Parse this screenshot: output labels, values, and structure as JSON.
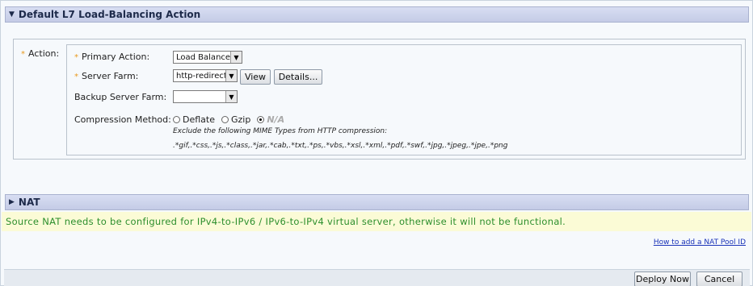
{
  "l7_section": {
    "title": "Default L7 Load-Balancing Action",
    "action_label": "Action:",
    "primary_action": {
      "label": "Primary Action:",
      "value": "Load Balance"
    },
    "server_farm": {
      "label": "Server Farm:",
      "value": "http-redirect",
      "view_label": "View",
      "details_label": "Details..."
    },
    "backup_server_farm": {
      "label": "Backup Server Farm:",
      "value": ""
    },
    "compression": {
      "label": "Compression Method:",
      "options": [
        "Deflate",
        "Gzip",
        "N/A"
      ],
      "selected": "N/A",
      "exclude_note": "Exclude the following MIME Types from HTTP compression:",
      "mime_types": ".*gif,.*css,.*js,.*class,.*jar,.*cab,.*txt,.*ps,.*vbs,.*xsl,.*xml,.*pdf,.*swf,.*jpg,.*jpeg,.*jpe,.*png"
    }
  },
  "nat_section": {
    "title": "NAT",
    "message": "Source NAT needs to be configured for IPv4-to-IPv6 / IPv6-to-IPv4 virtual server, otherwise it will not be functional.",
    "help_link": "How to add a NAT Pool ID"
  },
  "footer": {
    "deploy_label": "Deploy Now",
    "cancel_label": "Cancel"
  },
  "colors": {
    "header_bg": "#c4cbe6",
    "nat_message_bg": "#fbfbd6",
    "nat_message_text": "#2d8f2d",
    "required_star": "#e99a1e",
    "link": "#1a33b8"
  }
}
